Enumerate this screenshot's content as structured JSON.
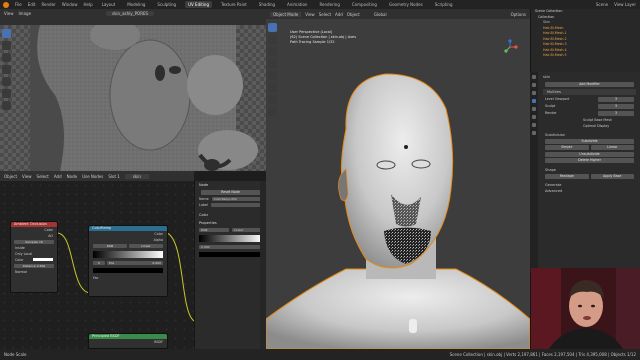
{
  "topbar": {
    "menus": [
      "File",
      "Edit",
      "Render",
      "Window",
      "Help"
    ],
    "workspaces": [
      "Layout",
      "Modeling",
      "Sculpting",
      "UV Editing",
      "Texture Paint",
      "Shading",
      "Animation",
      "Rendering",
      "Compositing",
      "Geometry Nodes",
      "Scripting"
    ],
    "active_workspace": "UV Editing",
    "scene": "Scene",
    "view_layer": "View Layer"
  },
  "uv_editor": {
    "header_menus": [
      "View",
      "Image"
    ],
    "image_name": "skin_ashly_PORES"
  },
  "node_editor": {
    "header_menus": [
      "Object",
      "View",
      "Select",
      "Add",
      "Node"
    ],
    "use_nodes": "Use Nodes",
    "slot": "Slot 1",
    "material": "skin",
    "nodes": {
      "ambient_occlusion": {
        "title": "Ambient Occlusion",
        "out_color": "Color",
        "out_ao": "AO",
        "samples_label": "Samples",
        "samples_value": "16",
        "inside": "Inside",
        "only_local": "Only Local",
        "color_label": "Color",
        "distance_label": "Distance",
        "distance_value": "0.500",
        "normal_label": "Normal"
      },
      "color_ramp": {
        "title": "ColorRamp",
        "out_color": "Color",
        "out_alpha": "Alpha",
        "mode": "RGB",
        "interp": "Linear",
        "pos_label": "0",
        "pos_field": "Pos",
        "pos_value": "0.000",
        "fac": "Fac"
      },
      "principled": {
        "title": "Principled BSDF",
        "out": "BSDF"
      }
    }
  },
  "n_panel": {
    "section_node": "Node",
    "reset_node": "Reset Node",
    "name_label": "Name",
    "name_value": "ColorRamp.002",
    "label_label": "Label",
    "color_section": "Color",
    "properties_section": "Properties",
    "mode": "RGB",
    "interp": "Linear",
    "pos_value": "0.000"
  },
  "viewport": {
    "header_menus": [
      "Object Mode",
      "View",
      "Select",
      "Add",
      "Object"
    ],
    "orientation": "Global",
    "options": "Options",
    "info_lines": [
      "User Perspective (Local)",
      "(62) Scene Collection | skin.obj | Axes",
      "Path Tracing Sample 1/32"
    ]
  },
  "outliner": {
    "title": "Scene Collection",
    "items": [
      "Collection",
      "Skin",
      "Hair.Bl.Mesh",
      "Hair.Bl.Mesh.1",
      "Hair.Bl.Mesh.2",
      "Hair.Bl.Mesh.3",
      "Hair.Bl.Mesh.4",
      "Hair.Bl.Mesh.5"
    ]
  },
  "properties": {
    "object": "skin",
    "add_modifier": "Add Modifier",
    "modifier_name": "Multires",
    "levels": [
      {
        "label": "Level Viewport",
        "value": "3"
      },
      {
        "label": "Sculpt",
        "value": "3"
      },
      {
        "label": "Render",
        "value": "3"
      }
    ],
    "sculpt_base_mesh": "Sculpt Base Mesh",
    "optimal_display": "Optimal Display",
    "subdivision": "Subdivision",
    "subdivide": "Subdivide",
    "simple": "Simple",
    "linear": "Linear",
    "unsubdivide": "Unsubdivide",
    "delete_higher": "Delete Higher",
    "shape": "Shape",
    "reshape": "Reshape",
    "apply_base": "Apply Base",
    "generate": "Generate",
    "advanced": "Advanced"
  },
  "status": {
    "left": "Node Scale",
    "right": "Scene Collection | skin.obj | Verts 2,197,861 | Faces 2,197,504 | Tris 4,395,008 | Objects 1/12"
  },
  "colors": {
    "accent": "#e87d0d",
    "blue": "#4772b3",
    "node_input": "#c43b3b",
    "node_converter": "#2a6f8f",
    "node_shader": "#3a8a4a"
  }
}
